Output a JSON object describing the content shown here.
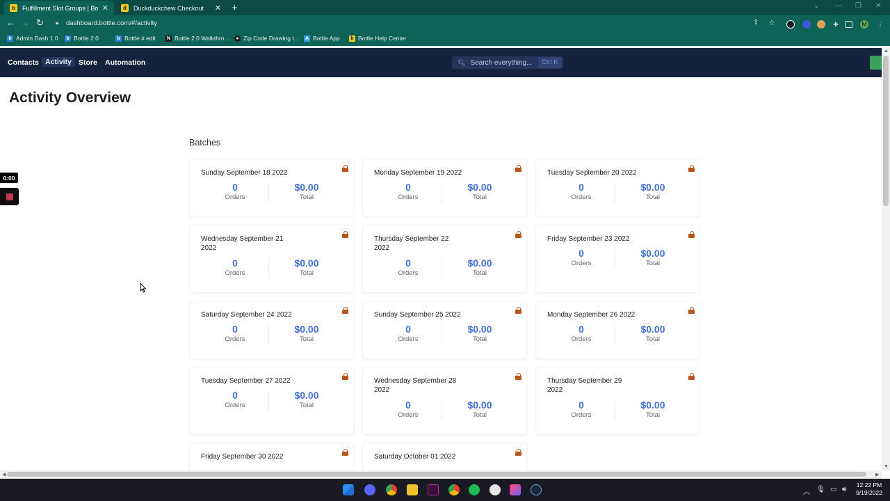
{
  "browser": {
    "tabs": [
      {
        "label": "Fulfillment Slot Groups | Bottle D",
        "active": true
      },
      {
        "label": "Duckduckchew Checkout",
        "active": false
      }
    ],
    "url": "dashboard.bottle.com/#/activity",
    "bookmarks": [
      {
        "label": "Admin Dash 1.0"
      },
      {
        "label": "Bottle 2.0"
      },
      {
        "label": "Bottle # edit"
      },
      {
        "label": "Bottle 2.0 Walkthro..."
      },
      {
        "label": "Zip Code Drawing t..."
      },
      {
        "label": "Bottle App"
      },
      {
        "label": "Bottle Help Center"
      }
    ]
  },
  "nav": {
    "items": [
      {
        "label": "Contacts"
      },
      {
        "label": "Activity",
        "active": true
      },
      {
        "label": "Store"
      },
      {
        "label": "Automation"
      }
    ],
    "search_placeholder": "Search everything...",
    "search_shortcut": "Ctrl K"
  },
  "page": {
    "title": "Activity Overview",
    "section": "Batches"
  },
  "batches": [
    {
      "date": "Sunday September 18 2022",
      "orders": "0",
      "total": "$0.00"
    },
    {
      "date": "Monday September 19 2022",
      "orders": "0",
      "total": "$0.00"
    },
    {
      "date": "Tuesday September 20 2022",
      "orders": "0",
      "total": "$0.00"
    },
    {
      "date": "Wednesday September 21 2022",
      "orders": "0",
      "total": "$0.00"
    },
    {
      "date": "Thursday September 22 2022",
      "orders": "0",
      "total": "$0.00"
    },
    {
      "date": "Friday September 23 2022",
      "orders": "0",
      "total": "$0.00"
    },
    {
      "date": "Saturday September 24 2022",
      "orders": "0",
      "total": "$0.00"
    },
    {
      "date": "Sunday September 25 2022",
      "orders": "0",
      "total": "$0.00"
    },
    {
      "date": "Monday September 26 2022",
      "orders": "0",
      "total": "$0.00"
    },
    {
      "date": "Tuesday September 27 2022",
      "orders": "0",
      "total": "$0.00"
    },
    {
      "date": "Wednesday September 28 2022",
      "orders": "0",
      "total": "$0.00"
    },
    {
      "date": "Thursday September 29 2022",
      "orders": "0",
      "total": "$0.00"
    },
    {
      "date": "Friday September 30 2022",
      "orders": "",
      "total": ""
    },
    {
      "date": "Saturday October 01 2022",
      "orders": "",
      "total": ""
    }
  ],
  "labels": {
    "orders": "Orders",
    "total": "Total"
  },
  "recorder": {
    "time": "0:00"
  },
  "taskbar": {
    "time": "12:22 PM",
    "date": "9/19/2022"
  }
}
